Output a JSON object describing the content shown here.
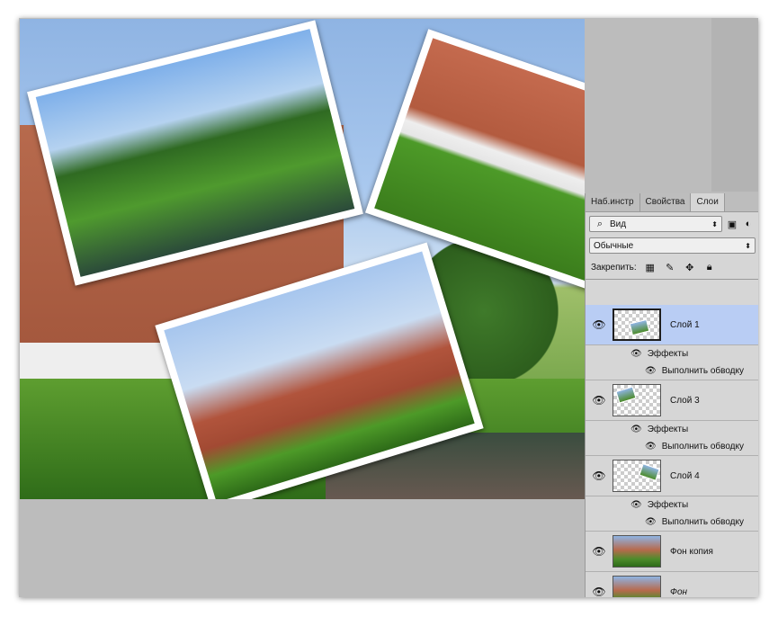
{
  "tabs": [
    {
      "label": "Наб.инстр"
    },
    {
      "label": "Свойства"
    },
    {
      "label": "Слои"
    }
  ],
  "filter": {
    "kind_label": "Вид"
  },
  "blend_mode": "Обычные",
  "lock_label": "Закрепить:",
  "icons": {
    "search": "search-icon",
    "image_filter": "image-filter-icon",
    "adjustment_filter": "adjustment-filter-icon",
    "lock_transparent": "lock-transparent-icon",
    "lock_paint": "lock-paint-icon",
    "lock_move": "lock-position-icon",
    "lock_all": "lock-icon",
    "eye": "eye-icon"
  },
  "layers": [
    {
      "name": "Слой 1",
      "effects": "Эффекты",
      "stroke": "Выполнить обводку",
      "selected": true
    },
    {
      "name": "Слой 3",
      "effects": "Эффекты",
      "stroke": "Выполнить обводку"
    },
    {
      "name": "Слой 4",
      "effects": "Эффекты",
      "stroke": "Выполнить обводку"
    },
    {
      "name": "Фон копия"
    },
    {
      "name": "Фон"
    }
  ],
  "colors": {
    "selected_row": "#b9cdf4",
    "panel_bg": "#d6d6d6"
  }
}
